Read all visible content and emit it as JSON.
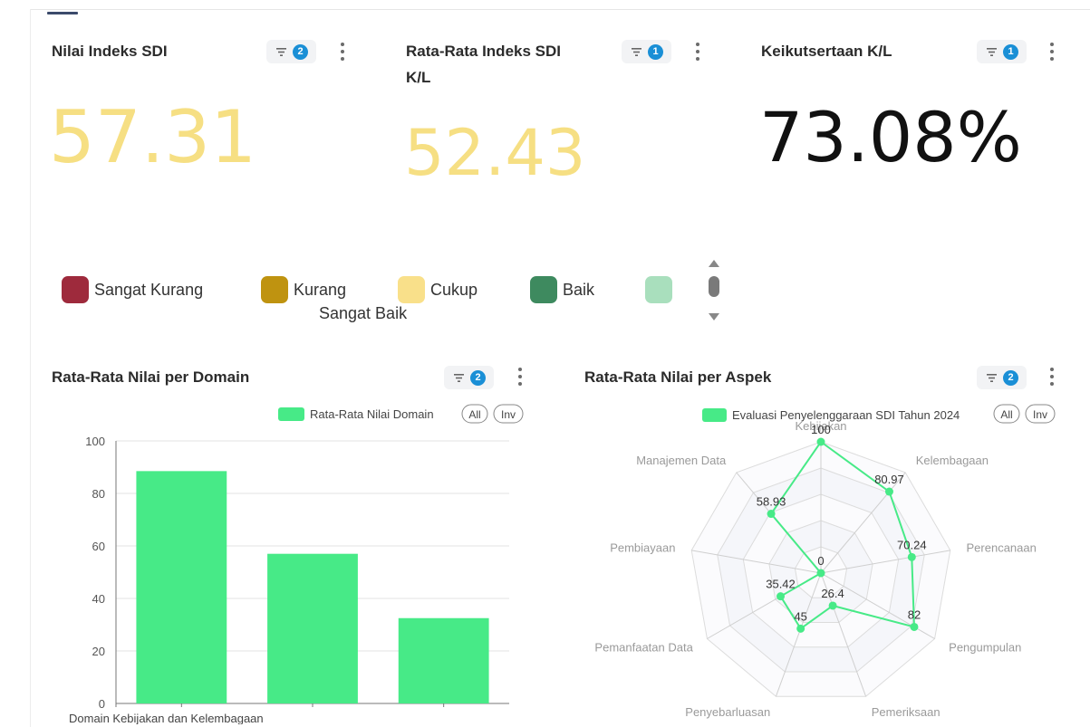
{
  "cards": [
    {
      "title": "Nilai Indeks SDI",
      "filter_count": "2",
      "value": "57.31",
      "value_color": "#f6df83"
    },
    {
      "title_line1": "Rata-Rata Indeks SDI",
      "title_line2": "K/L",
      "filter_count": "1",
      "value": "52.43",
      "value_color": "#f6df83"
    },
    {
      "title": "Keikutsertaan K/L",
      "filter_count": "1",
      "value": "73.08%",
      "value_color": "#111111"
    }
  ],
  "legend": {
    "items": [
      {
        "label": "Sangat Kurang",
        "color": "#9e2a3c"
      },
      {
        "label": "Kurang",
        "color": "#bf9310"
      },
      {
        "label": "Cukup",
        "color": "#f9e08a"
      },
      {
        "label": "Baik",
        "color": "#3e8a5f"
      },
      {
        "label": "Sangat Baik",
        "color": "#a9dfbd"
      }
    ]
  },
  "domain_panel": {
    "title": "Rata-Rata Nilai per Domain",
    "filter_count": "2"
  },
  "aspect_panel": {
    "title": "Rata-Rata Nilai per Aspek",
    "filter_count": "2"
  },
  "chart_data": [
    {
      "type": "bar",
      "legend": "Rata-Rata Nilai Domain",
      "legend_buttons": [
        "All",
        "Inv"
      ],
      "categories": [
        "Domain Kebijakan dan Kelembagaan",
        "",
        ""
      ],
      "series": [
        {
          "name": "Rata-Rata Nilai Domain",
          "values": [
            88.5,
            57,
            32.5
          ],
          "color": "#47ea87"
        }
      ],
      "ylim": [
        0,
        100
      ],
      "yticks": [
        0,
        20,
        40,
        60,
        80,
        100
      ],
      "grid": true
    },
    {
      "type": "radar",
      "legend": "Evaluasi Penyelenggaraan SDI Tahun 2024",
      "legend_buttons": [
        "All",
        "Inv"
      ],
      "axes": [
        "Kebijakan",
        "Kelembagaan",
        "Perencanaan",
        "Pengumpulan",
        "Pemeriksaan",
        "Penyebarluasan",
        "Pemanfaatan Data",
        "Pembiayaan",
        "Manajemen Data"
      ],
      "series": [
        {
          "name": "Evaluasi Penyelenggaraan SDI Tahun 2024",
          "values": [
            100,
            80.97,
            70.24,
            82,
            26.4,
            45,
            35.42,
            0,
            58.93
          ],
          "color": "#47ea87"
        }
      ],
      "value_labels": [
        "100",
        "80.97",
        "70.24",
        "82",
        "26.4",
        "45",
        "35.42",
        "0",
        "58.93"
      ],
      "range": [
        0,
        100
      ]
    }
  ]
}
